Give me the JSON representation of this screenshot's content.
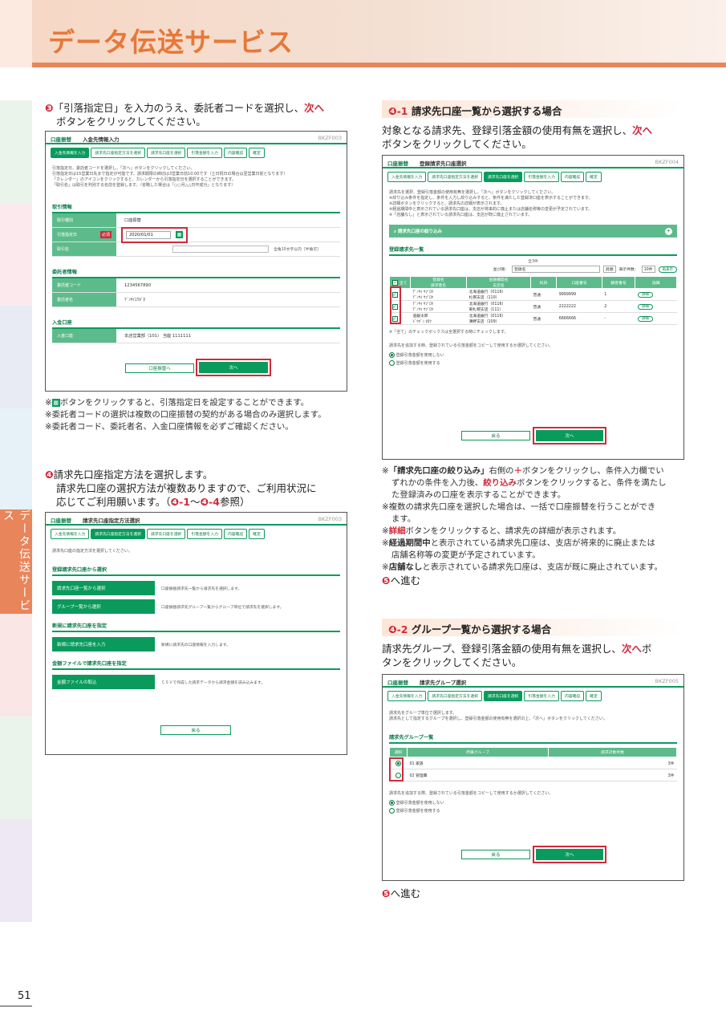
{
  "header": {
    "title": "データ伝送サービス"
  },
  "sidebar": {
    "label": "データ伝送サービス"
  },
  "page": {
    "number": "51"
  },
  "step3": {
    "num": "❸",
    "text1": "「引落指定日」を入力のうえ、委託者コードを選択し、",
    "next": "次へ",
    "text2": "ボタンをクリックしてください。"
  },
  "shot1": {
    "brand": "口座振替",
    "title": "入金先情報入力",
    "id": "BKZF003",
    "steps": [
      "入金先情報を入力",
      "請求先口座指定方法を選択",
      "請求先口座を選択",
      "引落金額を入力",
      "内容確認",
      "確定"
    ],
    "intro": [
      "引落指定日、委託者コードを選択し、「次へ」ボタンをクリックしてください。",
      "引落指定日は15営業日先まで指定が可能です。請求期限の締切は3営業日前10:00です（土日祝日の場合は翌営業日前となります）",
      "「カレンダー」のアイコンをクリックすると、カレンダーから引落指定日を選択することができます。",
      "「取引名」は取引を判別する名前を登録します。（省略した場合は「○○月△△日作成分」となります）"
    ],
    "sec1": "取引情報",
    "sec2": "委託者情報",
    "sec3": "入金口座",
    "rows1": [
      {
        "label": "取引種別",
        "value": "口座振替"
      },
      {
        "label": "引落指定日",
        "value": "2020/01/01"
      },
      {
        "label": "取引名",
        "value": ""
      }
    ],
    "required": "必須",
    "namehint": "全角10文字以内［半角可］",
    "rows2": [
      {
        "label": "委託者コード",
        "value": "1234567890"
      },
      {
        "label": "委託者名",
        "value": "ﾃﾞﾝｻｲﾕｳｶﾞﾀ"
      }
    ],
    "rows3": [
      {
        "label": "入金口座",
        "value": "本店営業部（101） 当座 1111111"
      }
    ],
    "back": "口座振替へ",
    "next": "次へ"
  },
  "notes1": [
    "※",
    "ボタンをクリックすると、引落指定日を設定することができます。",
    "※委託者コードの選択は複数の口座振替の契約がある場合のみ選択します。",
    "※委託者コード、委託者名、入金口座情報を必ずご確認ください。"
  ],
  "step4": {
    "num": "❹",
    "line1": "請求先口座指定方法を選択します。",
    "line2": "請求先口座の選択方法が複数ありますので、ご利用状況に",
    "line3": "応じてご利用願います。（",
    "r1": "❹-1",
    "tilde": "〜",
    "r2": "❹-4",
    "ref": "参照）"
  },
  "shot2": {
    "brand": "口座振替",
    "title": "請求先口座指定方法選択",
    "id": "BKZF003",
    "steps": [
      "入金先情報を入力",
      "請求先口座指定方法を選択",
      "請求先口座を選択",
      "引落金額を入力",
      "内容確認",
      "確定"
    ],
    "intro": "請求先口座の指定方法を選択してください。",
    "h1": "登録請求先口座から選択",
    "h2": "新規に請求先口座を指定",
    "h3": "金額ファイルで請求先口座を指定",
    "opts": [
      {
        "btn": "請求先口座一覧から選択",
        "desc": "口座振替請求先一覧から請求先を選択します。"
      },
      {
        "btn": "グループ一覧から選択",
        "desc": "口座振替請求先グループ一覧からグループ単位で請求先を選択します。"
      },
      {
        "btn": "新規に請求先口座を入力",
        "desc": "新規に請求先の口座情報を入力します。"
      },
      {
        "btn": "金額ファイルの取込",
        "desc": "ＣＳＶで作成した請求データから請求金額を読み込みます。"
      }
    ],
    "back": "戻る"
  },
  "sec41": {
    "num": "❹-1",
    "title": "請求先口座一覧から選択する場合",
    "t1": "対象となる請求先、登録引落金額の使用有無を選択し、",
    "next": "次へ",
    "t2": "ボタンをクリックしてください。"
  },
  "shot3": {
    "brand": "口座振替",
    "title": "登録請求先口座選択",
    "id": "BKZF004",
    "steps": [
      "入金先情報を入力",
      "請求先口座指定方法を選択",
      "請求先口座を選択",
      "引落金額を入力",
      "内容確認",
      "確定"
    ],
    "intro": [
      "請求先を選択、登録引落金額の使用有無を選択し、「次へ」ボタンをクリックしてください。",
      "※絞り込み条件を指定し、条件を入力し絞り込みすると、条件を満たした登録済口座を表示することができます。",
      "※詳細ボタンをクリックすると、請求先の詳細が表示されます。",
      "※経過期間中と表示されている請求先口座は、支店が将来的に廃止または店舗名称等の変更が予定されています。",
      "※「店舗なし」と表示されている請求先口座は、支店が既に廃止されています。"
    ],
    "filter": "請求先口座の絞り込み",
    "listh": "登録請求先一覧",
    "count": "全3件",
    "sortlabel": "並び順：",
    "sortval": "登録名",
    "order": "昇順",
    "perpage": "表示件数：",
    "perval": "10件",
    "redisplay": "再表示",
    "cols": [
      "全て",
      "登録名\n請求者名",
      "金融機関名\n支店名",
      "科目",
      "口座番号",
      "顧客番号",
      "詳細"
    ],
    "rows": [
      {
        "name": "ﾃﾞﾝｻｲ ｻﾌﾞﾛｳ",
        "kana": "ﾃﾞﾝｻｲ ｻﾌﾞﾛｳ",
        "bank": "北海道銀行（0116）",
        "branch": "札幌支店（110）",
        "type": "普通",
        "acct": "9999999",
        "cust": "1",
        "detail": "詳細"
      },
      {
        "name": "ﾃﾞﾝｻｲ ｻﾌﾞﾛｳ",
        "kana": "ﾃﾞﾝｻｲ ｻﾌﾞﾛｳ",
        "bank": "北海道銀行（0116）",
        "branch": "東札幌支店（111）",
        "type": "普通",
        "acct": "2222222",
        "cust": "2",
        "detail": "詳細"
      },
      {
        "name": "道銀太郎",
        "kana": "ﾄﾞｳｷﾞﾝ ﾀﾛｳ",
        "bank": "北海道銀行（0116）",
        "branch": "薄野支店（109）",
        "type": "普通",
        "acct": "6666666",
        "cust": "-",
        "detail": "詳細"
      }
    ],
    "tnote": "※「全て」のチェックボックスは全選択する時にチェックします。",
    "q": "請求先を追加する時、登録されている引落金額をコピーして使用するか選択してください。",
    "r1": "登録引落金額を使用しない",
    "r2": "登録引落金額を使用する",
    "back": "戻る",
    "next": "次へ"
  },
  "notes41": [
    {
      "a": "※",
      "b": "「請求先口座の絞り込み」",
      "c": "右側の",
      "d": "＋",
      "e": "ボタンをクリックし、条件入力欄でい"
    },
    {
      "t": "ずれかの条件を入力後、",
      "r": "絞り込み",
      "u": "ボタンをクリックすると、条件を満たし"
    },
    {
      "t": "た登録済みの口座を表示することができます。"
    },
    {
      "t": "※複数の請求先口座を選択した場合は、一括で口座振替を行うことができ"
    },
    {
      "t": "ます。"
    },
    {
      "a": "※",
      "r": "詳細",
      "u": "ボタンをクリックすると、請求先の詳細が表示されます。"
    },
    {
      "a": "※",
      "b": "経過期間中",
      "u": "と表示されている請求先口座は、支店が将来的に廃止または"
    },
    {
      "t": "店舗名称等の変更が予定されています。"
    },
    {
      "a": "※",
      "b": "店舗なし",
      "u": "と表示されている請求先口座は、支店が既に廃止されています。"
    }
  ],
  "goto1": {
    "num": "❺",
    "text": "へ進む"
  },
  "sec42": {
    "num": "❹-2",
    "title": "グループ一覧から選択する場合",
    "t1": "請求先グループ、登録引落金額の使用有無を選択し、",
    "next": "次へ",
    "t2": "ボ",
    "t3": "タンをクリックしてください。"
  },
  "shot4": {
    "brand": "口座振替",
    "title": "請求先グループ選択",
    "id": "BKZF005",
    "steps": [
      "入金先情報を入力",
      "請求先口座指定方法を選択",
      "請求先口座を選択",
      "引落金額を入力",
      "内容確認",
      "確定"
    ],
    "intro": [
      "請求先をグループ単位で選択します。",
      "請求先として指定するグループを選択し、登録引落金額の使用有無を選択の上、「次へ」ボタンをクリックしてください。"
    ],
    "listh": "請求先グループ一覧",
    "cols": [
      "選択",
      "所属グループ",
      "請求対象件数"
    ],
    "rows": [
      {
        "name": "01 家族",
        "count": "3件"
      },
      {
        "name": "02 管理費",
        "count": "3件"
      }
    ],
    "q": "請求先を追加する際、登録されている引落金額をコピーして使用するか選択してください。",
    "r1": "登録引落金額を使用しない",
    "r2": "登録引落金額を使用する",
    "back": "戻る",
    "next": "次へ"
  },
  "goto2": {
    "num": "❺",
    "text": "へ進む"
  }
}
